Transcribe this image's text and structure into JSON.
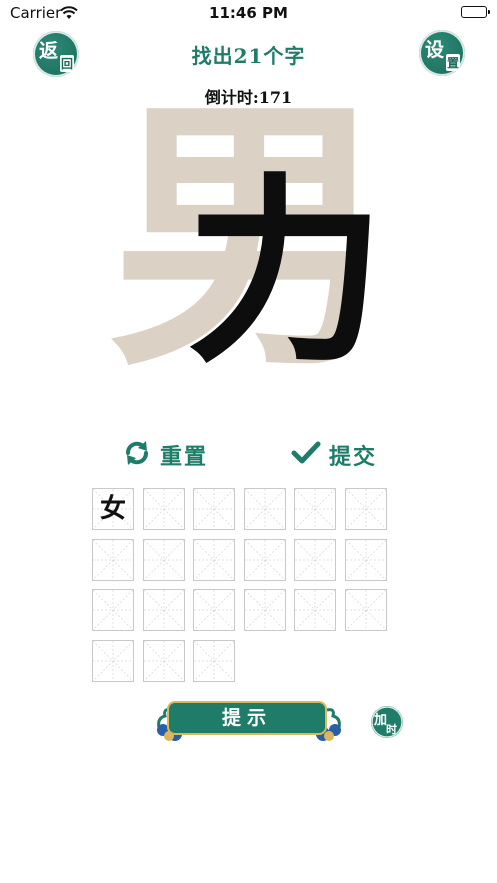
{
  "status_bar": {
    "carrier": "Carrier",
    "time": "11:46 PM"
  },
  "header": {
    "back_badge": {
      "char1": "返",
      "char2": "回"
    },
    "settings_badge": {
      "char1": "设",
      "char2": "置"
    },
    "title": "找出21个字",
    "countdown": "倒计时:171"
  },
  "puzzle": {
    "ghost_char": "男",
    "highlight_char": "力"
  },
  "actions": {
    "reset_label": "重置",
    "submit_label": "提交"
  },
  "grid": {
    "cells": [
      "女",
      "",
      "",
      "",
      "",
      "",
      "",
      "",
      "",
      "",
      "",
      "",
      "",
      "",
      "",
      "",
      "",
      "",
      "",
      "",
      ""
    ]
  },
  "hint_button": {
    "label": "提示"
  },
  "add_time_badge": {
    "char1": "加",
    "char2": "时"
  },
  "colors": {
    "accent": "#1f7c69",
    "ghost": "#dbd1c5",
    "gold": "#d8b85a"
  }
}
